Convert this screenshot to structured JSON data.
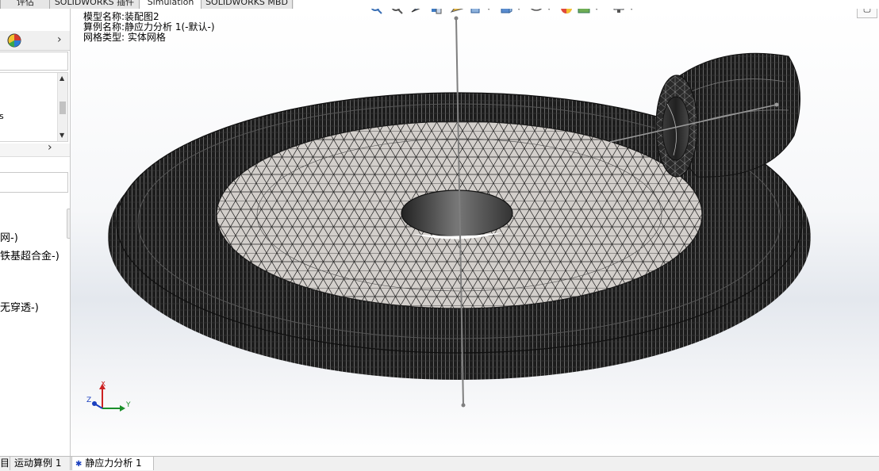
{
  "top_tabs": [
    {
      "label": "评估"
    },
    {
      "label": "SOLIDWORKS 插件"
    },
    {
      "label": "Simulation"
    },
    {
      "label": "SOLIDWORKS MBD"
    }
  ],
  "left_panel": {
    "tree_items": [
      {
        "label": "s"
      },
      {
        "label": "网-)"
      },
      {
        "label": "铁基超合金-)"
      },
      {
        "label": "无穿透-)"
      }
    ]
  },
  "viewport": {
    "model_name": "模型名称:装配图2",
    "study_name": "算例名称:静应力分析 1(-默认-)",
    "mesh_type": "网格类型: 实体网格",
    "triad": {
      "x": "X",
      "y": "Y",
      "z": "Z"
    }
  },
  "heads_up_icons": [
    "zoom-to-fit-icon",
    "zoom-to-area-icon",
    "previous-view-icon",
    "section-view-icon",
    "view-orientation-icon",
    "display-style-icon",
    "hide-show-icon",
    "edit-appearance-icon",
    "apply-scene-icon",
    "view-settings-icon"
  ],
  "bottom_tabs": [
    {
      "label": "目"
    },
    {
      "label": "运动算例 1"
    },
    {
      "label": "静应力分析 1"
    }
  ],
  "colors": {
    "mesh_dark": "#141414",
    "mesh_light": "#cdc9c5",
    "axis_line": "#7f7f7f",
    "accent_red": "#cc2222",
    "accent_green": "#1a8f2a",
    "accent_blue": "#1a3fbf"
  }
}
